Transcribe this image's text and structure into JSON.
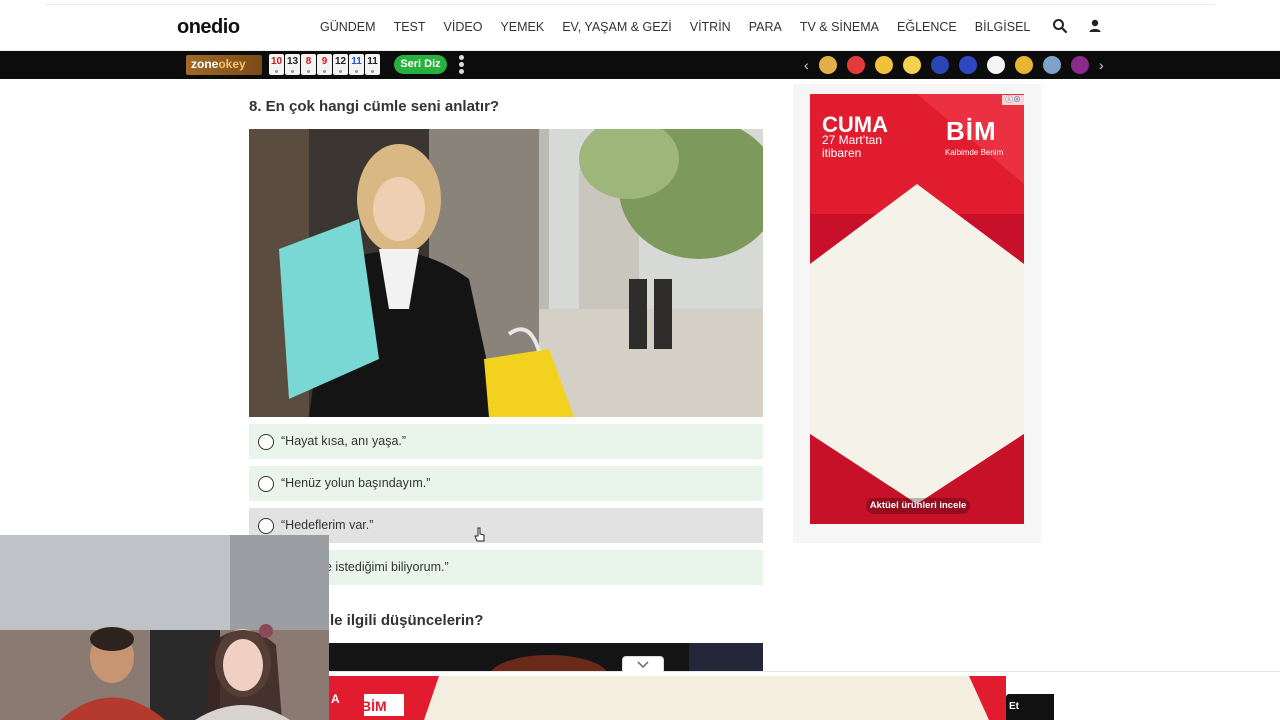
{
  "header": {
    "logo": "onedio",
    "nav": [
      "GÜNDEM",
      "TEST",
      "VİDEO",
      "YEMEK",
      "EV, YAŞAM & GEZİ",
      "VİTRİN",
      "PARA",
      "TV & SİNEMA",
      "EĞLENCE",
      "BİLGİSEL"
    ],
    "icons": [
      "search-icon",
      "user-icon"
    ]
  },
  "promo_bar": {
    "zone_part1": "zone",
    "zone_part2": "okey",
    "tiles": [
      {
        "n": "10",
        "c": "#d11a1a"
      },
      {
        "n": "13",
        "c": "#222222"
      },
      {
        "n": "8",
        "c": "#d11a1a"
      },
      {
        "n": "9",
        "c": "#d11a1a"
      },
      {
        "n": "12",
        "c": "#222222"
      },
      {
        "n": "11",
        "c": "#2456c8"
      },
      {
        "n": "11",
        "c": "#222222"
      }
    ],
    "button": "Seri Diz",
    "emojis": [
      "#e2b04a",
      "#e33b3b",
      "#f0c23a",
      "#f4d04f",
      "#2c46b8",
      "#2d48c0",
      "#f5f5f5",
      "#e8b532",
      "#7fa3c8",
      "#8a2a8a"
    ]
  },
  "question": {
    "title": "8. En çok hangi cümle seni anlatır?",
    "options": [
      "“Hayat kısa, anı yaşa.”",
      "“Henüz yolun başındayım.”",
      "“Hedeflerim var.”",
      "e istediğimi biliyorum.”"
    ]
  },
  "next_question": {
    "title": "le ilgili düşüncelerin?"
  },
  "ad": {
    "headline": "CUMA",
    "sub1": "27 Mart’tan",
    "sub2": "itibaren",
    "brand": "BİM",
    "slogan": "Kalbimde Benim",
    "cta": "Aktüel ürünleri incele"
  },
  "bottom_ad": {
    "brand": "BİM",
    "edge": "A",
    "button": "Et"
  }
}
